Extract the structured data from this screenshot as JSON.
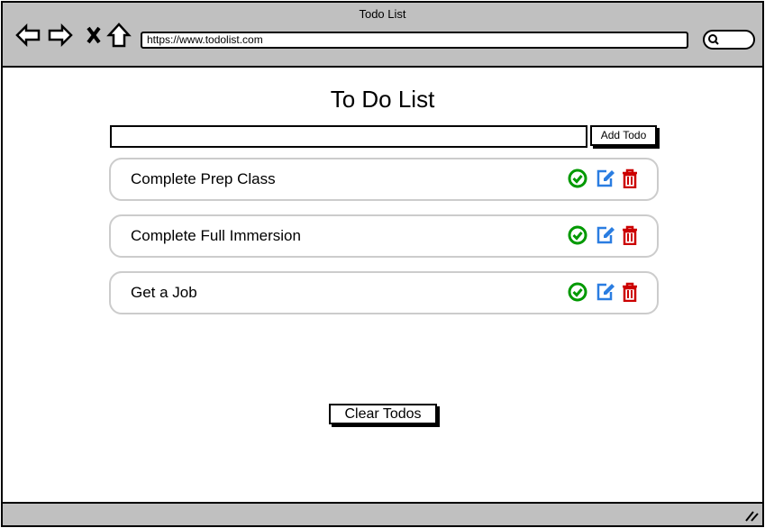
{
  "window": {
    "title": "Todo List",
    "url": "https://www.todolist.com"
  },
  "page": {
    "title": "To Do List",
    "input_value": "",
    "add_label": "Add Todo",
    "clear_label": "Clear Todos"
  },
  "todos": [
    {
      "label": "Complete Prep Class"
    },
    {
      "label": "Complete Full Immersion"
    },
    {
      "label": "Get a Job"
    }
  ],
  "colors": {
    "complete": "#009900",
    "edit": "#2a7de1",
    "delete": "#cc0000"
  },
  "icons": [
    "back-arrow-icon",
    "forward-arrow-icon",
    "close-icon",
    "home-icon",
    "search-icon",
    "check-circle-icon",
    "edit-icon",
    "trash-icon",
    "resize-grip-icon"
  ]
}
